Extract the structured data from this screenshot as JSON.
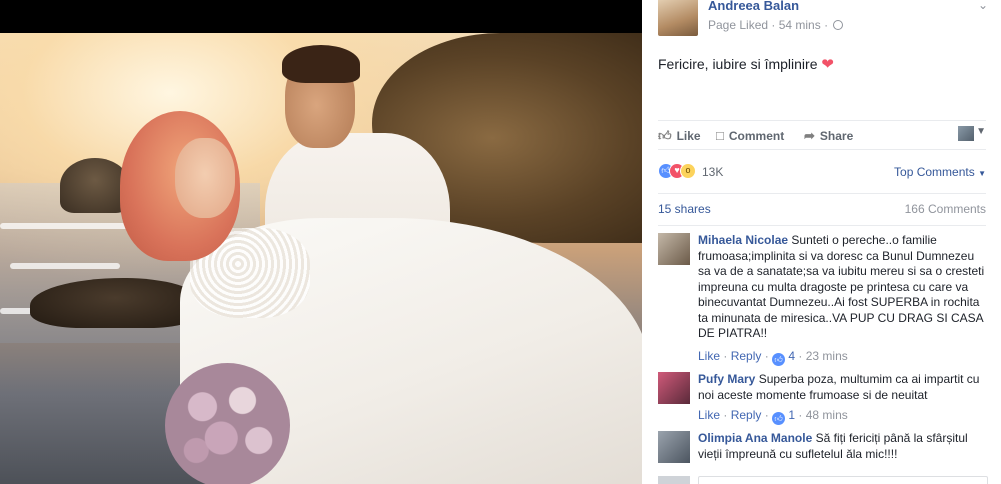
{
  "colors": {
    "link": "#365899",
    "muted": "#90949c",
    "like_blue": "#5890ff",
    "love_red": "#f25268"
  },
  "photo": {
    "icon": "wedding-photo"
  },
  "post": {
    "page_name": "Andreea Balan",
    "meta": "Page Liked · 54 mins ·",
    "text": "Fericire, iubire si împlinire",
    "emoji": "❤"
  },
  "actions": {
    "like": "Like",
    "comment": "Comment",
    "share": "Share"
  },
  "reactions": {
    "count": "13K",
    "top_comments": "Top Comments"
  },
  "stats": {
    "shares": "15 shares",
    "comments": "166 Comments"
  },
  "comments": [
    {
      "author": "Mihaela Nicolae",
      "text": "Sunteti o pereche..o familie frumoasa;implinita si va doresc ca Bunul Dumnezeu sa va de a sanatate;sa va iubitu mereu si sa o cresteti impreuna cu multa dragoste pe printesa cu care va binecuvantat Dumnezeu..Ai fost SUPERBA in rochita ta minunata de miresica..VA PUP CU DRAG SI CASA DE PIATRA!!",
      "like": "Like",
      "reply": "Reply",
      "likes": "4",
      "time": "23 mins"
    },
    {
      "author": "Pufy Mary",
      "text": "Superba poza, multumim ca ai impartit cu noi aceste momente frumoase si de neuitat",
      "like": "Like",
      "reply": "Reply",
      "likes": "1",
      "time": "48 mins"
    },
    {
      "author": "Olimpia Ana Manole",
      "text": "Să fiți fericiți până la sfârșitul vieții împreună cu sufletelul ăla mic!!!!"
    }
  ]
}
